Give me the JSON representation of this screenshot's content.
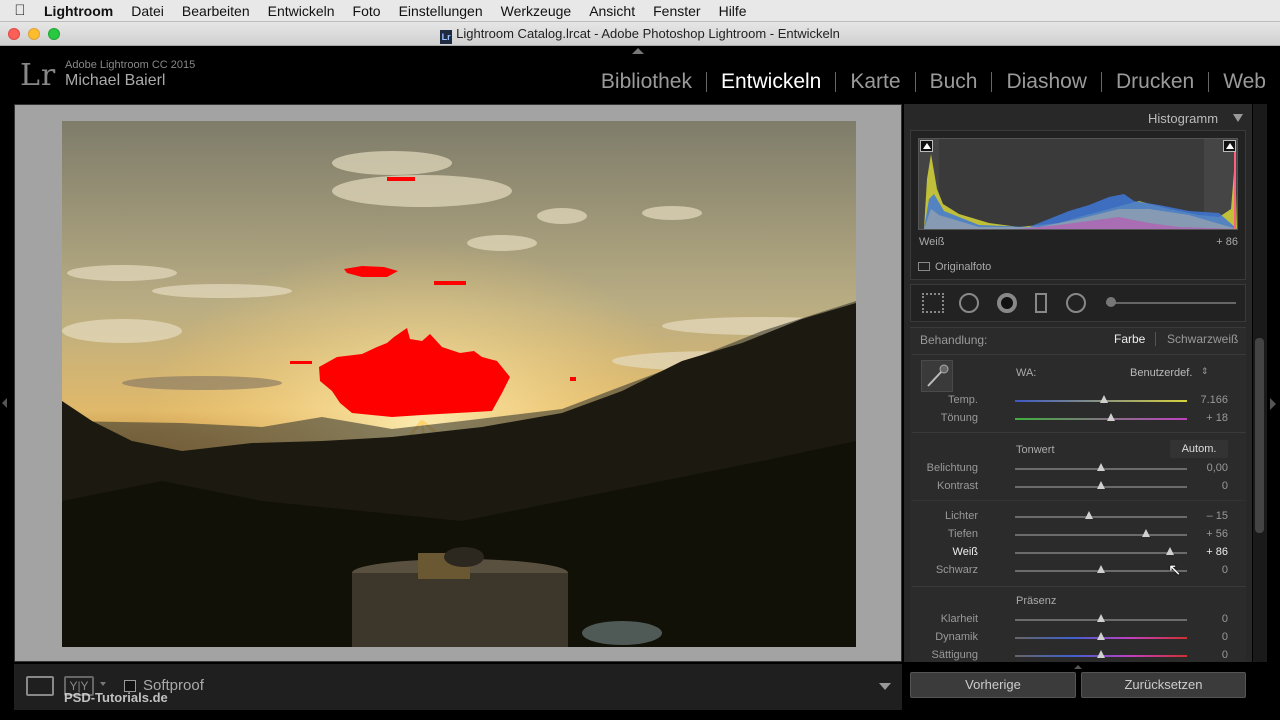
{
  "menubar": {
    "apple": "",
    "items": [
      "Lightroom",
      "Datei",
      "Bearbeiten",
      "Entwickeln",
      "Foto",
      "Einstellungen",
      "Werkzeuge",
      "Ansicht",
      "Fenster",
      "Hilfe"
    ]
  },
  "window": {
    "title": "Lightroom Catalog.lrcat - Adobe Photoshop Lightroom - Entwickeln",
    "doc_icon": "Lr"
  },
  "identity": {
    "logo": "Lr",
    "product": "Adobe Lightroom CC 2015",
    "user": "Michael Baierl"
  },
  "modules": [
    "Bibliothek",
    "Entwickeln",
    "Karte",
    "Buch",
    "Diashow",
    "Drucken",
    "Web"
  ],
  "active_module": "Entwickeln",
  "histogram": {
    "header": "Histogramm",
    "readout_label": "Weiß",
    "readout_value": "+ 86",
    "original_label": "Originalfoto"
  },
  "basic": {
    "treatment_label": "Behandlung:",
    "treatment_color": "Farbe",
    "treatment_bw": "Schwarzweiß",
    "wb_label": "WA:",
    "wb_value": "Benutzerdef.",
    "tone_label": "Tonwert",
    "auto_label": "Autom.",
    "presence_label": "Präsenz",
    "sliders": [
      {
        "label": "Temp.",
        "value": "7.166",
        "pos": 0.52
      },
      {
        "label": "Tönung",
        "value": "+ 18",
        "pos": 0.56
      },
      {
        "label": "Belichtung",
        "value": "0,00",
        "pos": 0.5
      },
      {
        "label": "Kontrast",
        "value": "0",
        "pos": 0.5
      },
      {
        "label": "Lichter",
        "value": "– 15",
        "pos": 0.43
      },
      {
        "label": "Tiefen",
        "value": "+ 56",
        "pos": 0.76
      },
      {
        "label": "Weiß",
        "value": "+ 86",
        "pos": 0.9
      },
      {
        "label": "Schwarz",
        "value": "0",
        "pos": 0.5
      },
      {
        "label": "Klarheit",
        "value": "0",
        "pos": 0.5
      },
      {
        "label": "Dynamik",
        "value": "0",
        "pos": 0.5
      },
      {
        "label": "Sättigung",
        "value": "0",
        "pos": 0.5
      }
    ]
  },
  "bottom": {
    "softproof_label": "Softproof",
    "watermark": "PSD-Tutorials.de",
    "prev_button": "Vorherige",
    "reset_button": "Zurücksetzen"
  },
  "colors": {
    "clipping": "#ff0000",
    "panel_bg": "#282828",
    "background_gray": "#a3a3a3"
  }
}
